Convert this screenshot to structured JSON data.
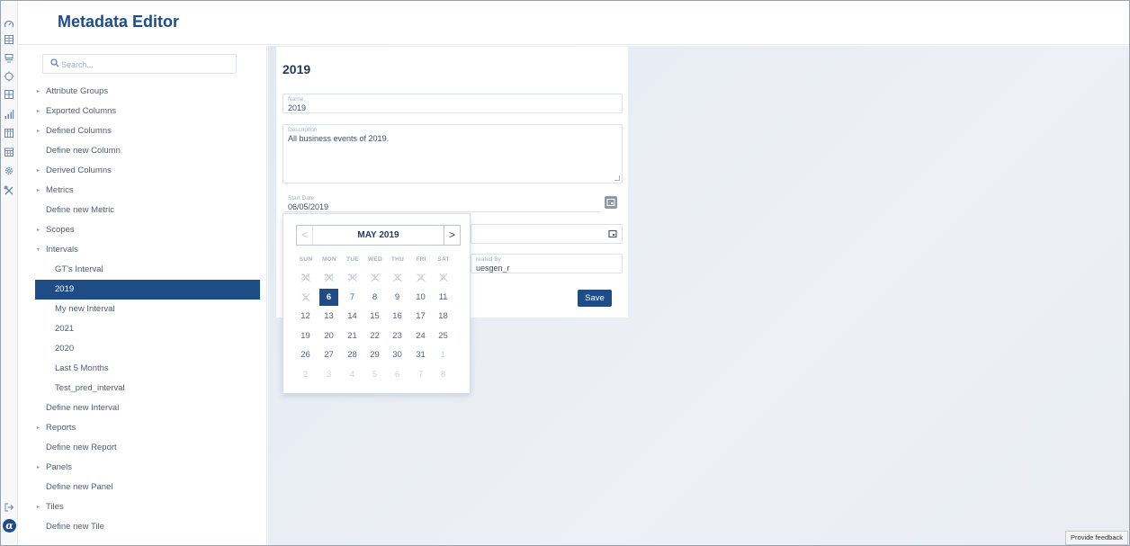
{
  "app": {
    "title": "Metadata Editor"
  },
  "rail_icons": [
    "gauge-icon",
    "grid-icon",
    "list-icon",
    "target-icon",
    "table-icon",
    "bar-chart-icon",
    "columns-icon",
    "calendar-grid-icon",
    "settings-icon",
    "tools-icon"
  ],
  "rail_bottom": {
    "exit_icon": "exit-icon",
    "logo": "α"
  },
  "search": {
    "placeholder": "Search..."
  },
  "nav": [
    {
      "label": "Attribute Groups",
      "caret": "▸",
      "level": 1
    },
    {
      "label": "Exported Columns",
      "caret": "▸",
      "level": 1
    },
    {
      "label": "Defined Columns",
      "caret": "▸",
      "level": 1
    },
    {
      "label": "Define new Column",
      "caret": "",
      "level": 1
    },
    {
      "label": "Derived Columns",
      "caret": "▸",
      "level": 1
    },
    {
      "label": "Metrics",
      "caret": "▸",
      "level": 1
    },
    {
      "label": "Define new Metric",
      "caret": "",
      "level": 1
    },
    {
      "label": "Scopes",
      "caret": "▸",
      "level": 1
    },
    {
      "label": "Intervals",
      "caret": "▾",
      "level": 1
    },
    {
      "label": "GT's Interval",
      "caret": "",
      "level": 2
    },
    {
      "label": "2019",
      "caret": "",
      "level": 2,
      "selected": true
    },
    {
      "label": "My new Interval",
      "caret": "",
      "level": 2
    },
    {
      "label": "2021",
      "caret": "",
      "level": 2
    },
    {
      "label": "2020",
      "caret": "",
      "level": 2
    },
    {
      "label": "Last 5 Months",
      "caret": "",
      "level": 2
    },
    {
      "label": "Test_pred_interval",
      "caret": "",
      "level": 2
    },
    {
      "label": "Define new Interval",
      "caret": "",
      "level": 1
    },
    {
      "label": "Reports",
      "caret": "▸",
      "level": 1
    },
    {
      "label": "Define new Report",
      "caret": "",
      "level": 1
    },
    {
      "label": "Panels",
      "caret": "▸",
      "level": 1
    },
    {
      "label": "Define new Panel",
      "caret": "",
      "level": 1
    },
    {
      "label": "Tiles",
      "caret": "▸",
      "level": 1
    },
    {
      "label": "Define new Tile",
      "caret": "",
      "level": 1
    }
  ],
  "form": {
    "heading": "2019",
    "name_label": "Name",
    "name_value": "2019",
    "description_label": "Description",
    "description_value": "All business events of 2019.",
    "start_date_label": "Start Date",
    "start_date_value": "06/05/2019",
    "created_by_label": "reated By",
    "created_by_value": "uesgen_r",
    "save_label": "Save"
  },
  "datepicker": {
    "month_label": "MAY 2019",
    "prev": "<",
    "next": ">",
    "weekdays": [
      "SUN",
      "MON",
      "TUE",
      "WED",
      "THU",
      "FRI",
      "SAT"
    ],
    "weeks": [
      [
        {
          "d": "28",
          "s": "dis"
        },
        {
          "d": "29",
          "s": "dis"
        },
        {
          "d": "30",
          "s": "dis"
        },
        {
          "d": "1",
          "s": "dis"
        },
        {
          "d": "2",
          "s": "dis"
        },
        {
          "d": "3",
          "s": "dis"
        },
        {
          "d": "4",
          "s": "dis"
        }
      ],
      [
        {
          "d": "5",
          "s": "dis"
        },
        {
          "d": "6",
          "s": "sel"
        },
        {
          "d": "7",
          "s": ""
        },
        {
          "d": "8",
          "s": ""
        },
        {
          "d": "9",
          "s": ""
        },
        {
          "d": "10",
          "s": ""
        },
        {
          "d": "11",
          "s": ""
        }
      ],
      [
        {
          "d": "12",
          "s": ""
        },
        {
          "d": "13",
          "s": ""
        },
        {
          "d": "14",
          "s": ""
        },
        {
          "d": "15",
          "s": ""
        },
        {
          "d": "16",
          "s": ""
        },
        {
          "d": "17",
          "s": ""
        },
        {
          "d": "18",
          "s": ""
        }
      ],
      [
        {
          "d": "19",
          "s": ""
        },
        {
          "d": "20",
          "s": ""
        },
        {
          "d": "21",
          "s": ""
        },
        {
          "d": "22",
          "s": ""
        },
        {
          "d": "23",
          "s": ""
        },
        {
          "d": "24",
          "s": ""
        },
        {
          "d": "25",
          "s": ""
        }
      ],
      [
        {
          "d": "26",
          "s": ""
        },
        {
          "d": "27",
          "s": ""
        },
        {
          "d": "28",
          "s": ""
        },
        {
          "d": "29",
          "s": ""
        },
        {
          "d": "30",
          "s": ""
        },
        {
          "d": "31",
          "s": ""
        },
        {
          "d": "1",
          "s": "other"
        }
      ],
      [
        {
          "d": "2",
          "s": "other"
        },
        {
          "d": "3",
          "s": "other"
        },
        {
          "d": "4",
          "s": "other"
        },
        {
          "d": "5",
          "s": "other"
        },
        {
          "d": "6",
          "s": "other"
        },
        {
          "d": "7",
          "s": "other"
        },
        {
          "d": "8",
          "s": "other"
        }
      ]
    ]
  },
  "feedback": {
    "label": "Provide feedback"
  },
  "colors": {
    "brand": "#1e4c87",
    "background": "#e9edf4"
  }
}
